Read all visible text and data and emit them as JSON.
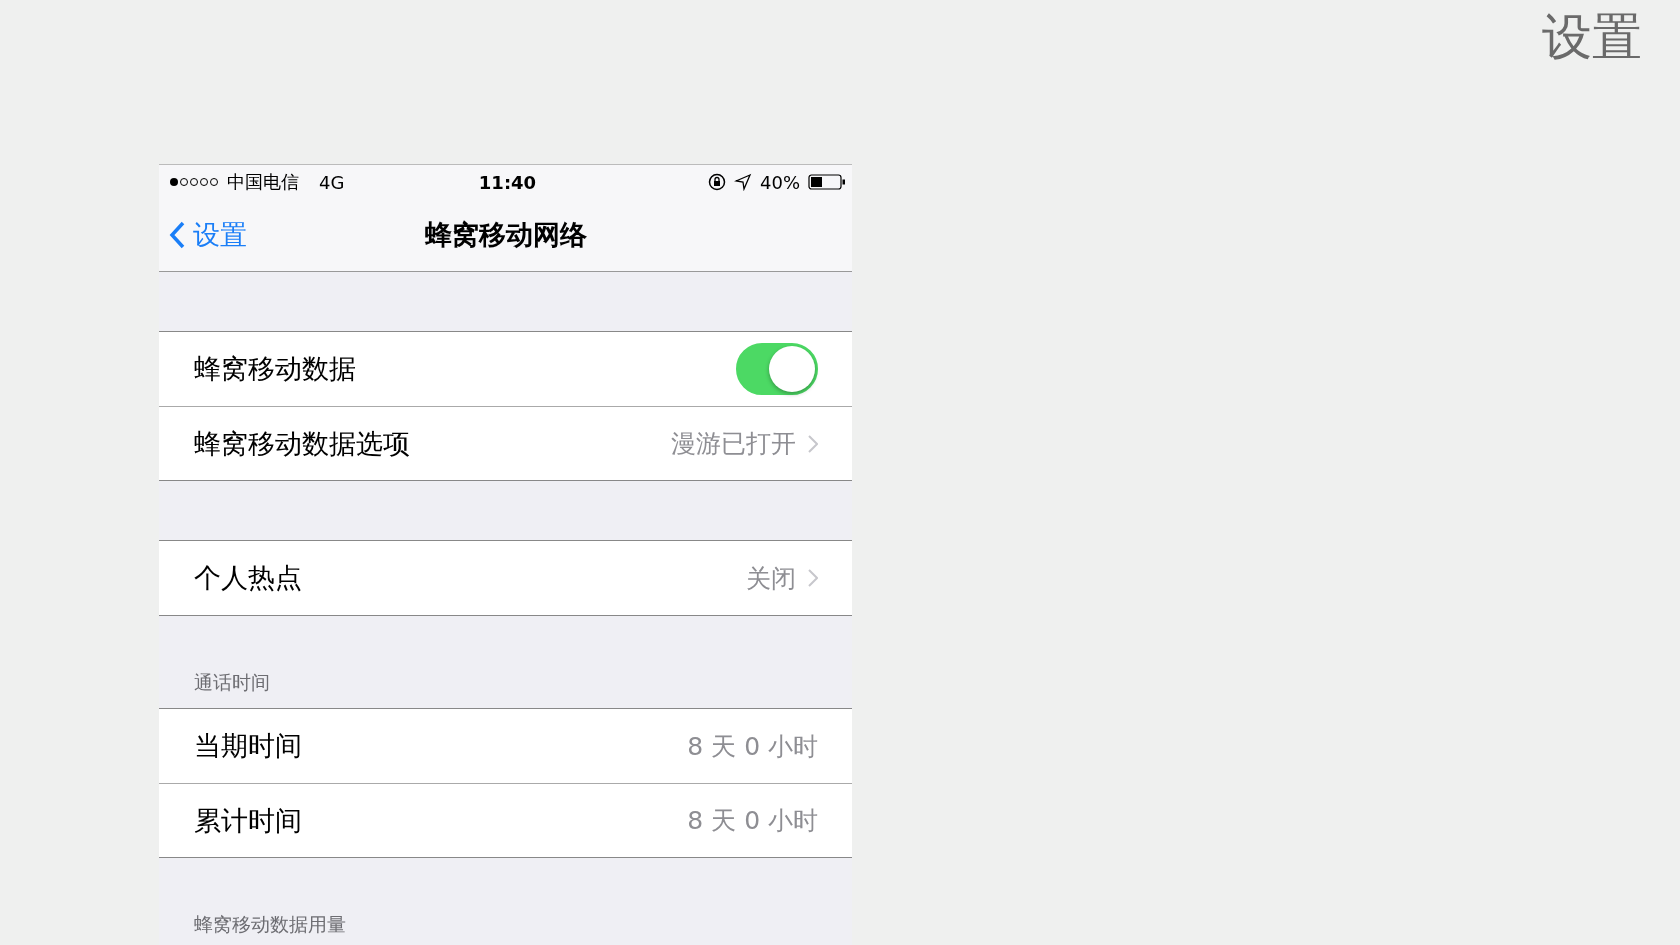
{
  "slide_title": "设置",
  "status_bar": {
    "carrier": "中国电信",
    "network": "4G",
    "time": "11:40",
    "battery": "40%"
  },
  "nav": {
    "back": "设置",
    "title": "蜂窝移动网络"
  },
  "groups": [
    {
      "rows": [
        {
          "kind": "toggle",
          "label": "蜂窝移动数据",
          "on": true
        },
        {
          "kind": "link",
          "label": "蜂窝移动数据选项",
          "value": "漫游已打开"
        }
      ]
    },
    {
      "rows": [
        {
          "kind": "link",
          "label": "个人热点",
          "value": "关闭"
        }
      ]
    },
    {
      "header": "通话时间",
      "rows": [
        {
          "kind": "value",
          "label": "当期时间",
          "value": "8 天 0 小时"
        },
        {
          "kind": "value",
          "label": "累计时间",
          "value": "8 天 0 小时"
        }
      ]
    },
    {
      "header": "蜂窝移动数据用量"
    }
  ]
}
